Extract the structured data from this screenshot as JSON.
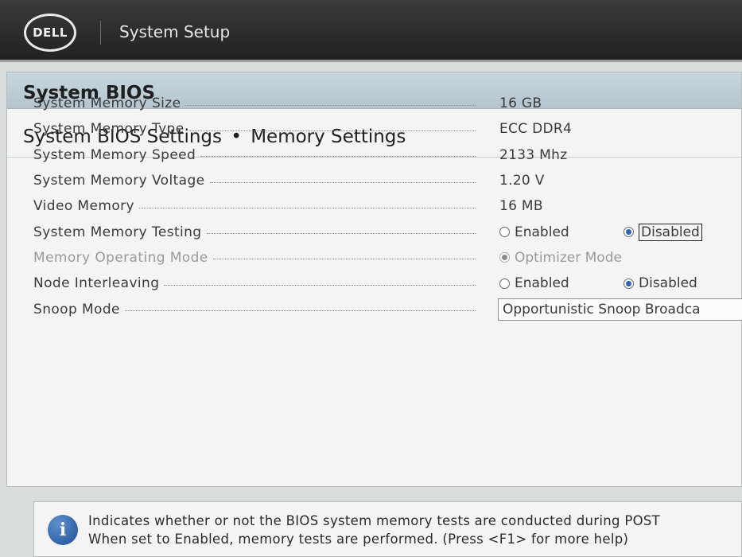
{
  "header": {
    "logo_text": "DELL",
    "app_title": "System Setup"
  },
  "section": {
    "title": "System BIOS",
    "breadcrumb_parent": "System BIOS Settings",
    "breadcrumb_separator": "•",
    "breadcrumb_current": "Memory Settings"
  },
  "settings": [
    {
      "label": "System Memory Size",
      "value": "16 GB"
    },
    {
      "label": "System Memory Type",
      "value": "ECC DDR4"
    },
    {
      "label": "System Memory Speed",
      "value": "2133 Mhz"
    },
    {
      "label": "System Memory Voltage",
      "value": "1.20 V"
    },
    {
      "label": "Video Memory",
      "value": "16 MB"
    },
    {
      "label": "System Memory Testing",
      "option1": "Enabled",
      "option2": "Disabled",
      "selected": "Disabled"
    },
    {
      "label": "Memory Operating Mode",
      "option1": "Optimizer Mode",
      "selected": "Optimizer Mode"
    },
    {
      "label": "Node Interleaving",
      "option1": "Enabled",
      "option2": "Disabled",
      "selected": "Disabled"
    },
    {
      "label": "Snoop Mode",
      "value": "Opportunistic Snoop Broadca"
    }
  ],
  "help": {
    "line1": "Indicates whether or not the BIOS system memory tests are conducted during POST",
    "line2": "When set to Enabled, memory tests are performed. (Press <F1> for more help)"
  },
  "colors": {
    "header_bg": "#2b2c2e",
    "section_header_bg": "#bccbd4",
    "radio_selected": "#2a63b0",
    "info_icon": "#2a5ca3"
  }
}
